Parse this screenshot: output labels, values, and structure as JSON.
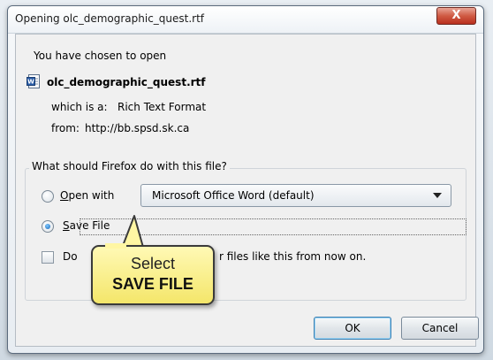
{
  "window": {
    "title": "Opening olc_demographic_quest.rtf",
    "close_label": "X"
  },
  "intro": {
    "heading": "You have chosen to open",
    "file_name": "olc_demographic_quest.rtf",
    "file_icon": "word-document-icon",
    "which_is_label": "which is a:",
    "which_is_value": "Rich Text Format",
    "from_label": "from:",
    "from_value": "http://bb.spsd.sk.ca"
  },
  "group": {
    "label": "What should Firefox do with this file?",
    "open_with": {
      "accel": "O",
      "rest": "pen with",
      "selected": false,
      "app_value": "Microsoft Office Word (default)"
    },
    "save_file": {
      "accel": "S",
      "rest": "ave File",
      "selected": true
    },
    "remember": {
      "label_start": "Do",
      "label_end": "r files like this from now on.",
      "checked": false
    }
  },
  "callout": {
    "line1": "Select",
    "line2": "SAVE FILE"
  },
  "buttons": {
    "ok": "OK",
    "cancel": "Cancel"
  }
}
